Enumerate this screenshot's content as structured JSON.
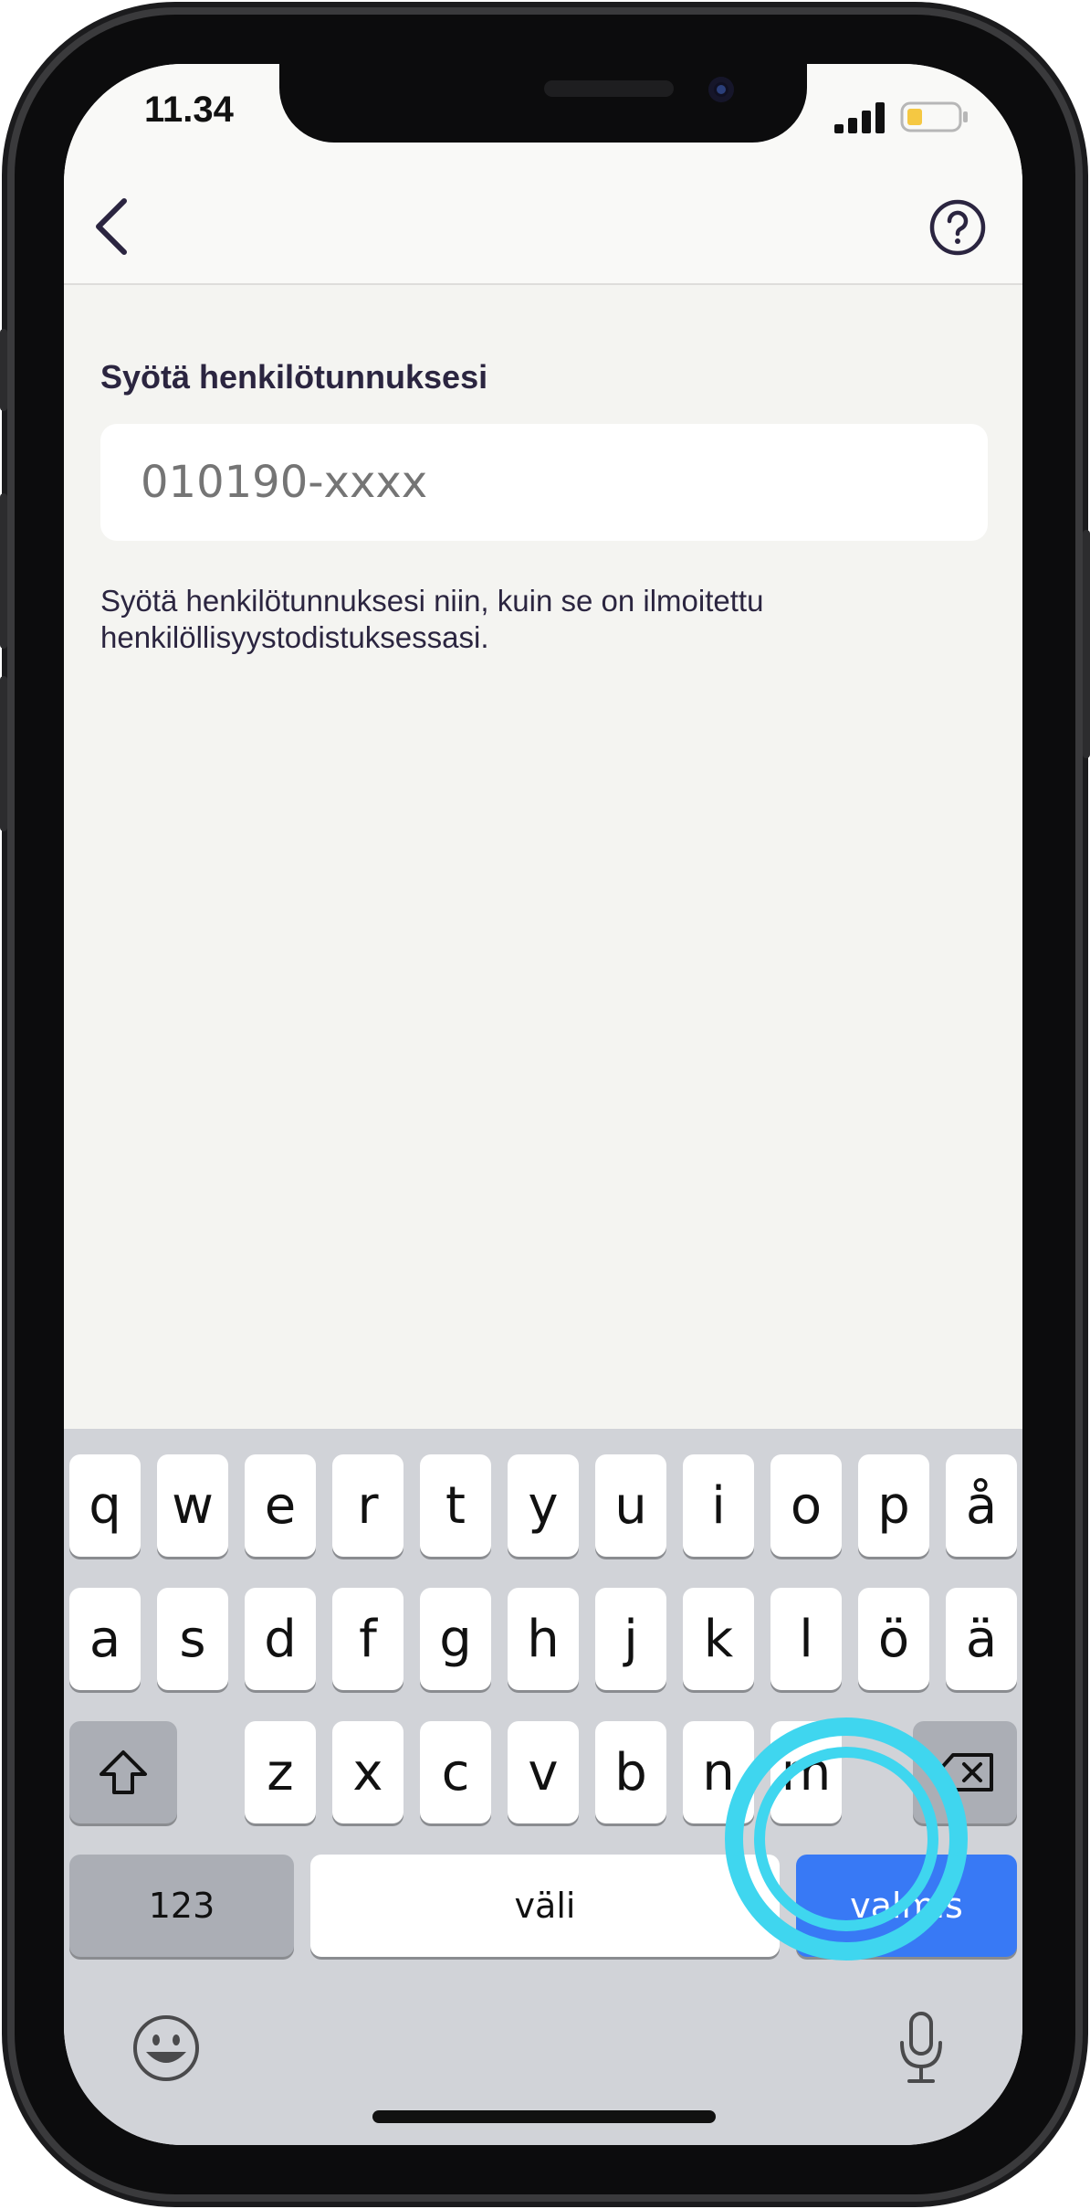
{
  "status_bar": {
    "time": "11.34",
    "battery_color": "#f5c842"
  },
  "nav": {
    "back_icon": "chevron-left-icon",
    "help_icon": "question-circle-icon"
  },
  "form": {
    "label": "Syötä henkilötunnuksesi",
    "input_placeholder": "010190-xxxx",
    "helper_text": "Syötä henkilötunnuksesi niin, kuin se on ilmoitettu henkilöllisyystodistuksessasi."
  },
  "keyboard": {
    "row1": [
      "q",
      "w",
      "e",
      "r",
      "t",
      "y",
      "u",
      "i",
      "o",
      "p",
      "å"
    ],
    "row2": [
      "a",
      "s",
      "d",
      "f",
      "g",
      "h",
      "j",
      "k",
      "l",
      "ö",
      "ä"
    ],
    "row3": [
      "z",
      "x",
      "c",
      "v",
      "b",
      "n",
      "m"
    ],
    "numbers_label": "123",
    "space_label": "väli",
    "done_label": "valmis",
    "shift_icon": "shift-icon",
    "delete_icon": "backspace-icon",
    "emoji_icon": "emoji-icon",
    "mic_icon": "microphone-icon"
  },
  "colors": {
    "accent": "#3879f5",
    "highlight": "#3fd6ef"
  }
}
